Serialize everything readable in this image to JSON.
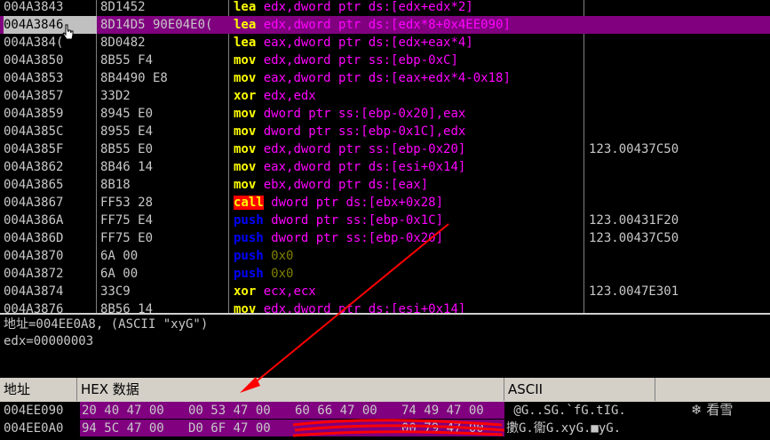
{
  "disasm": {
    "rows": [
      {
        "addr": "004A3843",
        "hex": "8D1452",
        "op": "lea",
        "operands": "edx,dword ptr ds:[edx+edx*2]",
        "comment": ""
      },
      {
        "addr": "004A3846",
        "hex": "8D14D5 90E04E0(",
        "op": "lea",
        "operands": "edx,dword ptr ds:[edx*8+0x4EE090]",
        "comment": "",
        "selected": true
      },
      {
        "addr": "004A384(",
        "hex": "8D0482",
        "op": "lea",
        "operands": "eax,dword ptr ds:[edx+eax*4]",
        "comment": ""
      },
      {
        "addr": "004A3850",
        "hex": "8B55 F4",
        "op": "mov",
        "operands": "edx,dword ptr ss:[ebp-0xC]",
        "comment": ""
      },
      {
        "addr": "004A3853",
        "hex": "8B4490 E8",
        "op": "mov",
        "operands": "eax,dword ptr ds:[eax+edx*4-0x18]",
        "comment": ""
      },
      {
        "addr": "004A3857",
        "hex": "33D2",
        "op": "xor",
        "operands": "edx,edx",
        "comment": ""
      },
      {
        "addr": "004A3859",
        "hex": "8945 E0",
        "op": "mov",
        "operands": "dword ptr ss:[ebp-0x20],eax",
        "comment": ""
      },
      {
        "addr": "004A385C",
        "hex": "8955 E4",
        "op": "mov",
        "operands": "dword ptr ss:[ebp-0x1C],edx",
        "comment": ""
      },
      {
        "addr": "004A385F",
        "hex": "8B55 E0",
        "op": "mov",
        "operands": "edx,dword ptr ss:[ebp-0x20]",
        "comment": "123.00437C50"
      },
      {
        "addr": "004A3862",
        "hex": "8B46 14",
        "op": "mov",
        "operands": "eax,dword ptr ds:[esi+0x14]",
        "comment": ""
      },
      {
        "addr": "004A3865",
        "hex": "8B18",
        "op": "mov",
        "operands": "ebx,dword ptr ds:[eax]",
        "comment": ""
      },
      {
        "addr": "004A3867",
        "hex": "FF53 28",
        "op": "call",
        "operands": "dword ptr ds:[ebx+0x28]",
        "comment": ""
      },
      {
        "addr": "004A386A",
        "hex": "FF75 E4",
        "op": "push",
        "operands": "dword ptr ss:[ebp-0x1C]",
        "comment": "123.00431F20"
      },
      {
        "addr": "004A386D",
        "hex": "FF75 E0",
        "op": "push",
        "operands": "dword ptr ss:[ebp-0x20]",
        "comment": "123.00437C50"
      },
      {
        "addr": "004A3870",
        "hex": "6A 00",
        "op": "push",
        "operands": "0x0",
        "comment": "",
        "imm": true
      },
      {
        "addr": "004A3872",
        "hex": "6A 00",
        "op": "push",
        "operands": "0x0",
        "comment": "",
        "imm": true
      },
      {
        "addr": "004A3874",
        "hex": "33C9",
        "op": "xor",
        "operands": "ecx,ecx",
        "comment": "123.0047E301"
      },
      {
        "addr": "004A3876",
        "hex": "8B56 14",
        "op": "mov",
        "operands": "edx,dword ptr ds:[esi+0x14]",
        "comment": ""
      }
    ]
  },
  "info": {
    "line1": "地址=004EE0A8, (ASCII \"xyG\")",
    "line2": "edx=00000003"
  },
  "dump": {
    "header": {
      "addr": "地址",
      "hex": "HEX 数据",
      "ascii": "ASCII"
    },
    "rows": [
      {
        "addr": "004EE090",
        "groups": [
          "20 40 47 00",
          "00 53 47 00",
          "60 66 47 00",
          "74 49 47 00"
        ],
        "ascii": " @G..SG.`fG.tIG."
      },
      {
        "addr": "004EE0A0",
        "groups": [
          "94 5C 47 00",
          "D0 6F 47 00",
          "",
          "00 79 47 00"
        ],
        "ascii": "擻G.衞G.xyG.■yG."
      }
    ]
  },
  "watermark": "看雪",
  "colors": {
    "selection": "#800080",
    "accent_red": "#ff0000"
  }
}
